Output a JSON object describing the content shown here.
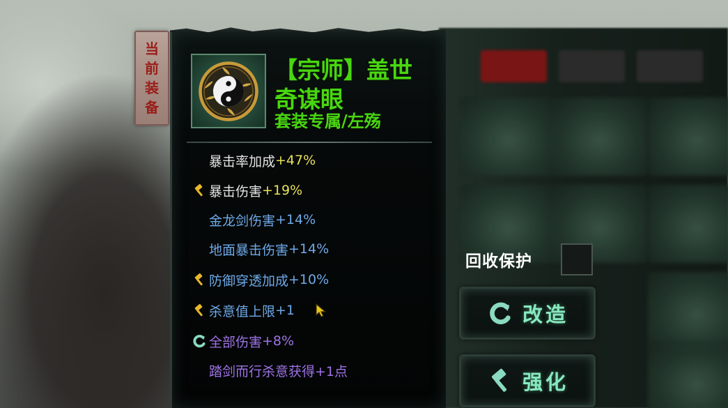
{
  "tag": {
    "chars": [
      "当",
      "前",
      "装",
      "备"
    ]
  },
  "item": {
    "title_line1": "【宗师】盖世",
    "title_line2": "奇谋眼",
    "subtitle": "套装专属/左殇",
    "icon": "yin-yang-laurel-icon"
  },
  "stats": [
    {
      "icon": "none",
      "name": "暴击率加成",
      "value": "+47%",
      "name_color": "#e4e4e4",
      "value_color": "#e8e05a"
    },
    {
      "icon": "hammer-icon",
      "name": "暴击伤害",
      "value": "+19%",
      "name_color": "#e4e4e4",
      "value_color": "#e8e05a"
    },
    {
      "icon": "none",
      "name": "金龙剑伤害",
      "value": "+14%",
      "name_color": "#6ea9e8",
      "value_color": "#6ea9e8"
    },
    {
      "icon": "none",
      "name": "地面暴击伤害",
      "value": "+14%",
      "name_color": "#6ea9e8",
      "value_color": "#6ea9e8"
    },
    {
      "icon": "hammer-icon",
      "name": "防御穿透加成",
      "value": "+10%",
      "name_color": "#6ea9e8",
      "value_color": "#6ea9e8"
    },
    {
      "icon": "hammer-icon",
      "name": "杀意值上限",
      "value": "+1",
      "name_color": "#6ea9e8",
      "value_color": "#6ea9e8"
    },
    {
      "icon": "reforge-icon",
      "name": "全部伤害",
      "value": "+8%",
      "name_color": "#9e73e6",
      "value_color": "#9e73e6"
    },
    {
      "icon": "none",
      "name": "踏剑而行杀意获得",
      "value": "+1点",
      "name_color": "#9e73e6",
      "value_color": "#9e73e6"
    }
  ],
  "protect": {
    "label": "回收保护",
    "checked": false
  },
  "buttons": {
    "reforge": {
      "label": "改造",
      "icon": "reforge-icon"
    },
    "enhance": {
      "label": "强化",
      "icon": "hammer-icon"
    }
  },
  "colors": {
    "title_green": "#49d60f",
    "button_text": "#88e9bf",
    "tag_red": "#9a1d18"
  }
}
